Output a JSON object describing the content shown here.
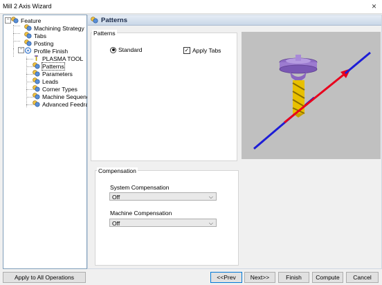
{
  "window": {
    "title": "Mill 2 Axis Wizard",
    "close_glyph": "×"
  },
  "tree": {
    "items": [
      {
        "label": "Feature",
        "icon": "feature-icon"
      },
      {
        "label": "Machining Strategy",
        "icon": "gear-blue-icon"
      },
      {
        "label": "Tabs",
        "icon": "gear-blue-icon"
      },
      {
        "label": "Posting",
        "icon": "gear-blue-icon"
      },
      {
        "label": "Profile Finish",
        "icon": "profile-op-icon"
      },
      {
        "label": "PLASMA TOOL",
        "icon": "tool-icon"
      },
      {
        "label": "Patterns",
        "icon": "gear-blue-icon"
      },
      {
        "label": "Parameters",
        "icon": "gear-blue-icon"
      },
      {
        "label": "Leads",
        "icon": "gear-blue-icon"
      },
      {
        "label": "Corner Types",
        "icon": "gear-blue-icon"
      },
      {
        "label": "Machine Sequence",
        "icon": "gear-blue-icon"
      },
      {
        "label": "Advanced Feedrates",
        "icon": "gear-blue-icon"
      }
    ],
    "selected": "Patterns"
  },
  "panel": {
    "title": "Patterns",
    "patterns_group": {
      "legend": "Patterns",
      "standard_label": "Standard",
      "standard_selected": true,
      "apply_tabs_label": "Apply Tabs",
      "apply_tabs_checked": true
    },
    "compensation_group": {
      "legend": "Compensation",
      "system_label": "System Compensation",
      "system_value": "Off",
      "machine_label": "Machine Compensation",
      "machine_value": "Off"
    }
  },
  "buttons": {
    "apply_all": "Apply to All Operations",
    "prev": "<<Prev",
    "next": "Next>>",
    "finish": "Finish",
    "compute": "Compute",
    "cancel": "Cancel"
  },
  "colors": {
    "preview_bg": "#c0c0c0",
    "arrow_red": "#e8001c",
    "arrow_blue": "#1d1dd6",
    "tool_purple": "#8e6cc4",
    "tool_gold": "#e8c000"
  }
}
